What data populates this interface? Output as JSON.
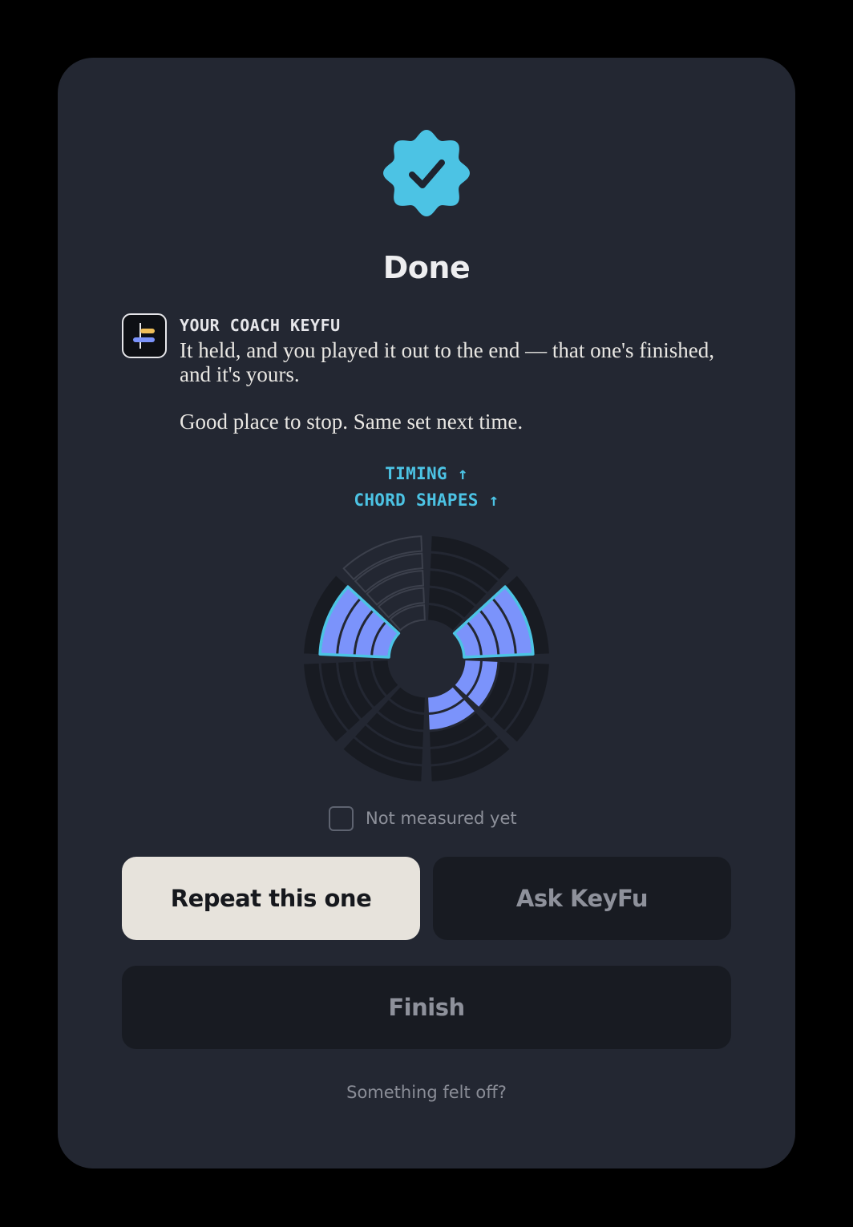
{
  "colors": {
    "background": "#000000",
    "card": "#232732",
    "accent": "#4cc3e4",
    "fill": "#7b93fb",
    "track": "#181b22",
    "primary_button": "#e7e3dc",
    "secondary_button": "#181b22"
  },
  "header": {
    "icon": "verified-badge-icon",
    "title": "Done"
  },
  "coach": {
    "avatar_icon": "keyfu-logo-icon",
    "name": "YOUR COACH KEYFU",
    "message_1": "It held, and you played it out to the end — that one's finished, and it's yours.",
    "message_2": "Good place to stop. Same set next time."
  },
  "gains": [
    {
      "label": "TIMING ↑"
    },
    {
      "label": "CHORD SHAPES ↑"
    }
  ],
  "chart_data": {
    "type": "radial-bar",
    "segments": 8,
    "rings": 5,
    "segment_values": [
      0,
      4,
      2,
      2,
      0,
      0,
      4,
      3
    ],
    "highlighted_segments": [
      1,
      6
    ],
    "unmeasured_segments": [
      7
    ]
  },
  "legend": {
    "label": "Not measured yet"
  },
  "actions": {
    "repeat_label": "Repeat this one",
    "ask_label": "Ask KeyFu",
    "finish_label": "Finish",
    "feedback_link": "Something felt off?"
  }
}
